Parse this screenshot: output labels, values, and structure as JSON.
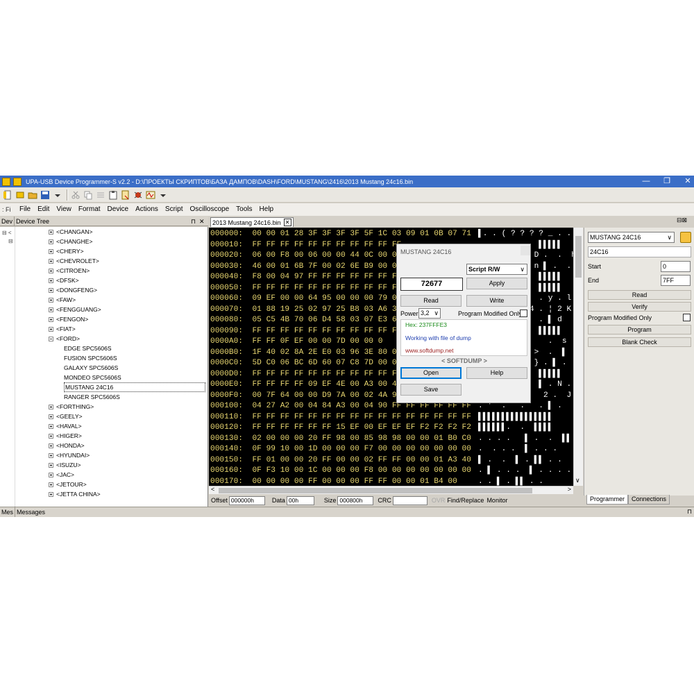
{
  "window": {
    "title": "UPA-USB Device Programmer-S v2.2 - D:\\ПРОЕКТЫ СКРИПТОВ\\БАЗА ДАМПОВ\\DASH\\FORD\\MUSTANG\\2416\\2013 Mustang 24c16.bin",
    "minimize": "—",
    "restore": "❐",
    "close": "✕"
  },
  "menu": {
    "grip": ": Fi",
    "items": [
      "File",
      "Edit",
      "View",
      "Format",
      "Device",
      "Actions",
      "Script",
      "Oscilloscope",
      "Tools",
      "Help"
    ]
  },
  "device_tree": {
    "header_tab": "Dev",
    "header_title": "Device Tree",
    "pin": "⊓",
    "close": "✕",
    "gutter_top": "⊟ <",
    "gutter_sub": "⊟",
    "items": [
      {
        "label": "<CHANGAN>",
        "level": 0,
        "expander": "plus"
      },
      {
        "label": "<CHANGHE>",
        "level": 0,
        "expander": "plus"
      },
      {
        "label": "<CHERY>",
        "level": 0,
        "expander": "plus"
      },
      {
        "label": "<CHEVROLET>",
        "level": 0,
        "expander": "plus"
      },
      {
        "label": "<CITROEN>",
        "level": 0,
        "expander": "plus"
      },
      {
        "label": "<DFSK>",
        "level": 0,
        "expander": "plus"
      },
      {
        "label": "<DONGFENG>",
        "level": 0,
        "expander": "plus"
      },
      {
        "label": "<FAW>",
        "level": 0,
        "expander": "plus"
      },
      {
        "label": "<FENGGUANG>",
        "level": 0,
        "expander": "plus"
      },
      {
        "label": "<FENGON>",
        "level": 0,
        "expander": "plus"
      },
      {
        "label": "<FIAT>",
        "level": 0,
        "expander": "plus"
      },
      {
        "label": "<FORD>",
        "level": 0,
        "expander": "minus"
      },
      {
        "label": "EDGE SPC5606S",
        "level": 1,
        "expander": "none"
      },
      {
        "label": "FUSION SPC5606S",
        "level": 1,
        "expander": "none"
      },
      {
        "label": "GALAXY SPC5606S",
        "level": 1,
        "expander": "none"
      },
      {
        "label": "MONDEO SPC5606S",
        "level": 1,
        "expander": "none"
      },
      {
        "label": "MUSTANG 24C16",
        "level": 1,
        "expander": "none",
        "selected": true
      },
      {
        "label": "RANGER SPC5606S",
        "level": 1,
        "expander": "none"
      },
      {
        "label": "<FORTHING>",
        "level": 0,
        "expander": "plus"
      },
      {
        "label": "<GEELY>",
        "level": 0,
        "expander": "plus"
      },
      {
        "label": "<HAVAL>",
        "level": 0,
        "expander": "plus"
      },
      {
        "label": "<HIGER>",
        "level": 0,
        "expander": "plus"
      },
      {
        "label": "<HONDA>",
        "level": 0,
        "expander": "plus"
      },
      {
        "label": "<HYUNDAI>",
        "level": 0,
        "expander": "plus"
      },
      {
        "label": "<ISUZU>",
        "level": 0,
        "expander": "plus"
      },
      {
        "label": "<JAC>",
        "level": 0,
        "expander": "plus"
      },
      {
        "label": "<JETOUR>",
        "level": 0,
        "expander": "plus"
      },
      {
        "label": "<JETTA CHINA>",
        "level": 0,
        "expander": "plus"
      }
    ]
  },
  "editor": {
    "tab_label": "2013 Mustang 24c16.bin",
    "tab_close": "✕",
    "rows": [
      {
        "addr": "000000:",
        "bytes": "00 00 01 28 3F 3F 3F 3F 5F 1C 03 09 01 0B 07 71",
        "ascii": "▌. . ( ? ? ? ? _ . . ."
      },
      {
        "addr": "000010:",
        "bytes": "FF FF FF FF FF FF FF FF FF FF FF",
        "ascii": "             ▌▌▌▌▌"
      },
      {
        "addr": "000020:",
        "bytes": "06 00 F8 00 06 00 00 44 0C 00 0",
        "ascii": "            D .  .  h"
      },
      {
        "addr": "000030:",
        "bytes": "46 00 01 6B 7F 00 02 6E B9 00 0",
        "ascii": "            n ▌ .  .  q"
      },
      {
        "addr": "000040:",
        "bytes": "F8 00 04 97 FF FF FF FF FF FF F",
        "ascii": "             ▌▌▌▌▌"
      },
      {
        "addr": "000050:",
        "bytes": "FF FF FF FF FF FF FF FF FF FF F",
        "ascii": "             ▌▌▌▌▌"
      },
      {
        "addr": "000060:",
        "bytes": "09 EF 00 00 64 95 00 00 00 79 0",
        "ascii": "             . y . l"
      },
      {
        "addr": "000070:",
        "bytes": "01 88 19 25 02 97 25 B8 03 A6 3",
        "ascii": "           4 . ¦ 2 K"
      },
      {
        "addr": "000080:",
        "bytes": "05 C5 4B 70 06 D4 58 03 07 E3 6",
        "ascii": "             . ▌ d"
      },
      {
        "addr": "000090:",
        "bytes": "FF FF FF FF FF FF FF FF FF FF F",
        "ascii": "             ▌▌▌▌▌"
      },
      {
        "addr": "0000A0:",
        "bytes": "FF FF 0F EF 00 00 7D 00 00 0",
        "ascii": "               .  s"
      },
      {
        "addr": "0000B0:",
        "bytes": "1F 40 02 8A 2E E0 03 96 3E 80 0",
        "ascii": "            >  .  ▌"
      },
      {
        "addr": "0000C0:",
        "bytes": "5D C0 06 BC 6D 60 07 C8 7D 00 0",
        "ascii": "            } . ▌ ."
      },
      {
        "addr": "0000D0:",
        "bytes": "FF FF FF FF FF FF FF FF FF FF F",
        "ascii": "             ▌▌▌▌▌"
      },
      {
        "addr": "0000E0:",
        "bytes": "FF FF FF FF 09 EF 4E 00 A3 00 4",
        "ascii": "             ▌ . N ."
      },
      {
        "addr": "0000F0:",
        "bytes": "00 7F 64 00 00 D9 7A 00 02 4A 9",
        "ascii": "              2 .  J"
      },
      {
        "addr": "000100:",
        "bytes": "04 27 A2 00 04 84 A3 00 04 90 FF FF FF FF FF FF",
        "ascii": ". '  .   .   . ▌ ."
      },
      {
        "addr": "000110:",
        "bytes": "FF FF FF FF FF FF FF FF FF FF FF FF FF FF FF FF",
        "ascii": "▌▌▌▌▌▌▌▌▌▌▌▌▌▌▌▌"
      },
      {
        "addr": "000120:",
        "bytes": "FF FF FF FF FF FF 15 EF 00 EF EF EF F2 F2 F2 F2",
        "ascii": "▌▌▌▌▌▌.  .  ▌▌▌▌"
      },
      {
        "addr": "000130:",
        "bytes": "02 00 00 00 20 FF 98 00 85 98 98 00 00 01 B0 C0",
        "ascii": ". . . .   ▌ .  .  ▌▌"
      },
      {
        "addr": "000140:",
        "bytes": "0F 99 10 00 1D 00 00 00 F7 00 00 00 00 00 00 00",
        "ascii": ".  . . .  ▌ . . ."
      },
      {
        "addr": "000150:",
        "bytes": "FF 01 00 00 20 FF 00 00 02 FF FF 00 00 01 A3 40",
        "ascii": "▌ .  .  ▌ . ▌▌ . ."
      },
      {
        "addr": "000160:",
        "bytes": "0F F3 10 00 1C 00 00 00 F8 00 00 00 00 00 00 00",
        "ascii": ". ▌ . . .  ▌ . . . ."
      },
      {
        "addr": "000170:",
        "bytes": "00 00 00 00 FF 00 00 00 FF FF 00 00 01 B4 00",
        "ascii": ". . ▌ . ▌▌ . ."
      }
    ]
  },
  "status_bar": {
    "offset_label": "Offset",
    "offset_value": "000000h",
    "data_label": "Data",
    "data_value": "00h",
    "size_label": "Size",
    "size_value": "000800h",
    "crc_label": "CRC",
    "crc_value": "",
    "ovr": "OVR",
    "find_replace": "Find/Replace",
    "monitor": "Monitor"
  },
  "right_panel": {
    "device_select": "MUSTANG 24C16",
    "chip": "24C16",
    "start_label": "Start",
    "start_value": "0",
    "end_label": "End",
    "end_value": "7FF",
    "read": "Read",
    "verify": "Verify",
    "program_modified_only": "Program Modified Only",
    "program": "Program",
    "blank_check": "Blank Check",
    "tabs": [
      "Programmer",
      "Connections"
    ],
    "pin": "⊟⊠"
  },
  "dialog": {
    "title": "MUSTANG 24C16",
    "script_select": "Script R/W",
    "code_value": "72677",
    "apply": "Apply",
    "read": "Read",
    "write": "Write",
    "power_label": "Power",
    "power_value": "3,2",
    "program_modified_only": "Program Modified Only",
    "info_hex": "Hex: 237FFFE3",
    "info_mode": "Working with file of dump",
    "info_url": "www.softdump.net",
    "brand": "< SOFTDUMP >",
    "open": "Open",
    "help": "Help",
    "save": "Save"
  },
  "messages": {
    "header_tab": "Mes",
    "header_title": "Messages",
    "pin": "⊓"
  },
  "colors": {
    "titlebar": "#3b6ec7",
    "hex_bg": "#000000",
    "hex_text": "#e8d670",
    "hex_ascii": "#ffffff",
    "info_green": "#1a8a1a",
    "info_blue": "#2040b0",
    "info_red": "#9a1b1b"
  }
}
